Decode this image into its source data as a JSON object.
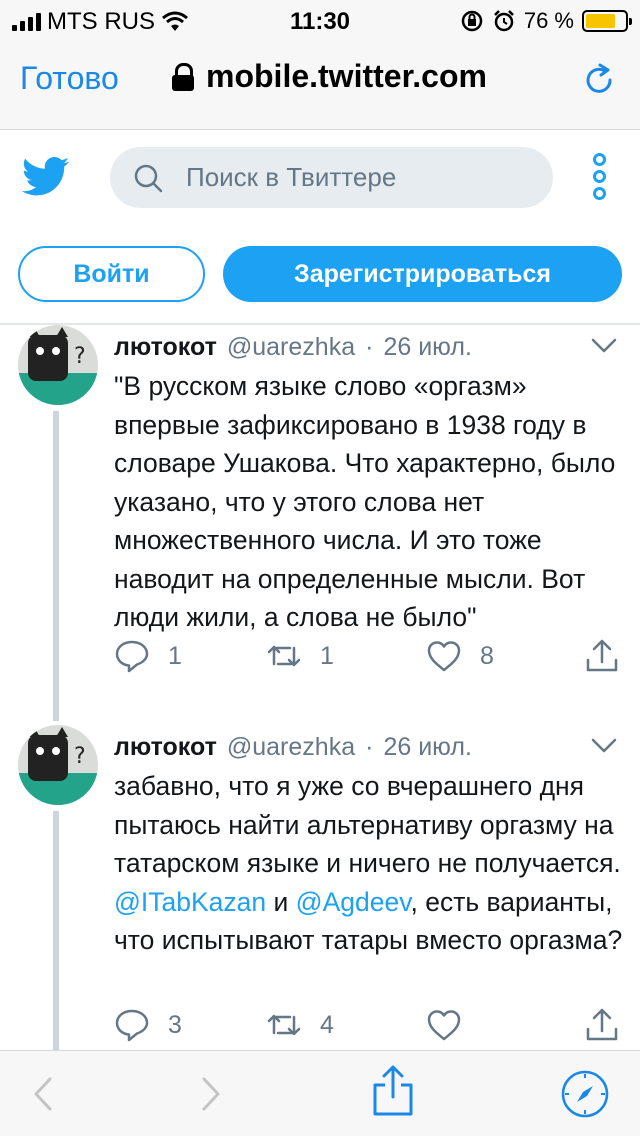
{
  "status_bar": {
    "carrier": "MTS RUS",
    "time": "11:30",
    "battery_percent": "76 %",
    "battery_level": 0.76
  },
  "browser": {
    "done_label": "Готово",
    "url": "mobile.twitter.com"
  },
  "header": {
    "search_placeholder": "Поиск в Твиттере"
  },
  "auth": {
    "login_label": "Войти",
    "register_label": "Зарегистрироваться"
  },
  "tweets": [
    {
      "name": "лютокот",
      "handle": "@uarezhka",
      "dot": "·",
      "date": "26 июл.",
      "text": "\"В русском языке слово «оргазм» впервые зафиксировано в 1938 году в словаре Ушакова. Что характерно, было указано, что у этого слова нет множественного числа. И это тоже наводит на определенные мысли. Вот люди жили, а слова не было\"",
      "replies": "1",
      "retweets": "1",
      "likes": "8"
    },
    {
      "name": "лютокот",
      "handle": "@uarezhka",
      "dot": "·",
      "date": "26 июл.",
      "text_part1": "забавно, что я уже со вчерашнего дня пытаюсь найти альтернативу оргазму на татарском языке и ничего не получается. ",
      "mention1": "@ITabKazan",
      "text_part2": " и ",
      "mention2": "@Agdeev",
      "text_part3": ", есть варианты, что испытывают татары вместо оргазма?",
      "replies": "3",
      "retweets": "4",
      "likes": ""
    }
  ],
  "colors": {
    "twitter_blue": "#1da1f2",
    "ios_blue": "#1b87e6",
    "muted_text": "#657786",
    "search_bg": "#e6ecf0"
  }
}
